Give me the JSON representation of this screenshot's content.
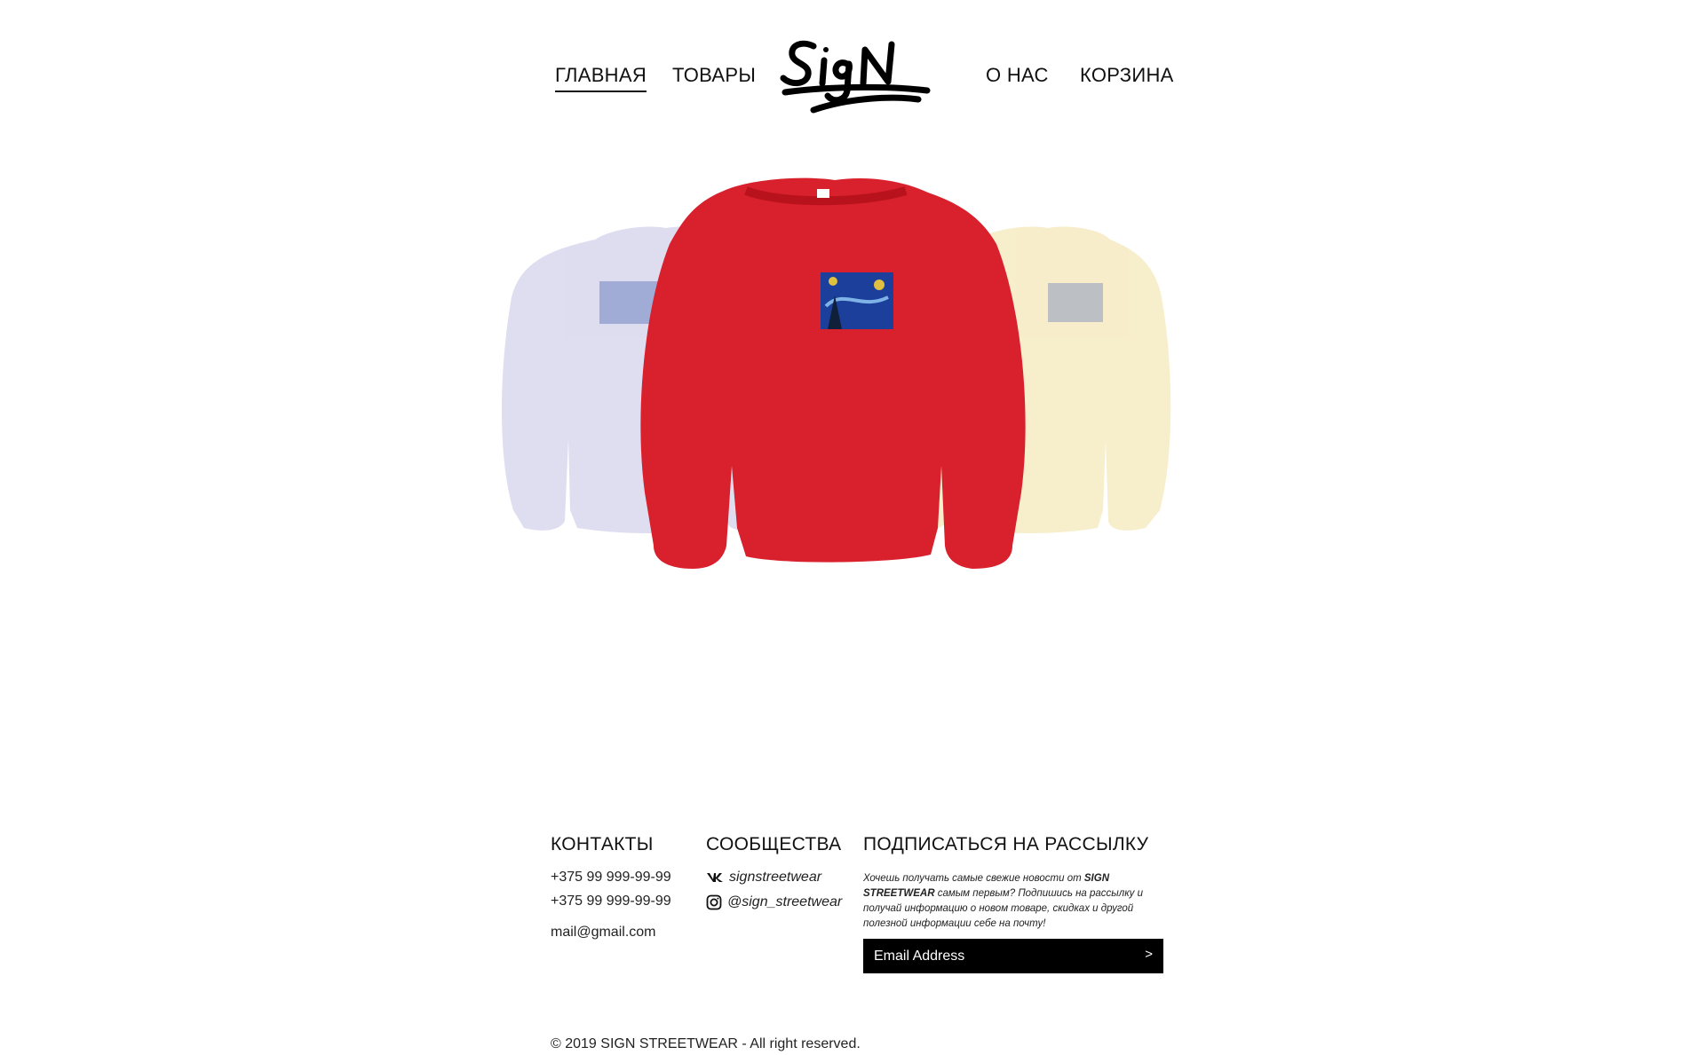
{
  "nav": {
    "items": [
      {
        "label": "ГЛАВНАЯ"
      },
      {
        "label": "ТОВАРЫ"
      },
      {
        "label": "О НАС"
      },
      {
        "label": "КОРЗИНА"
      }
    ],
    "logo_text": "SIGN"
  },
  "hero": {
    "products": [
      {
        "color": "#dddcf0"
      },
      {
        "color": "#d9202d"
      },
      {
        "color": "#f7edc8"
      }
    ]
  },
  "footer": {
    "contacts": {
      "title": "КОНТАКТЫ",
      "phone1": "+375 99 999-99-99",
      "phone2": "+375 99 999-99-99",
      "email": "mail@gmail.com"
    },
    "communities": {
      "title": "СООБЩЕСТВА",
      "vk": "signstreetwear",
      "instagram": "@sign_streetwear"
    },
    "subscribe": {
      "title": "ПОДПИСАТЬСЯ НА РАССЫЛКУ",
      "text_before": "Хочешь получать самые свежие новости от ",
      "brand": "SIGN STREETWEAR",
      "text_after": " самым первым? Подпишись на рассылку и получай информацию о новом товаре, скидках и другой полезной информации себе на почту!",
      "placeholder": "Email Address",
      "button": ">"
    },
    "copyright": "© 2019 SIGN STREETWEAR - All right reserved."
  }
}
